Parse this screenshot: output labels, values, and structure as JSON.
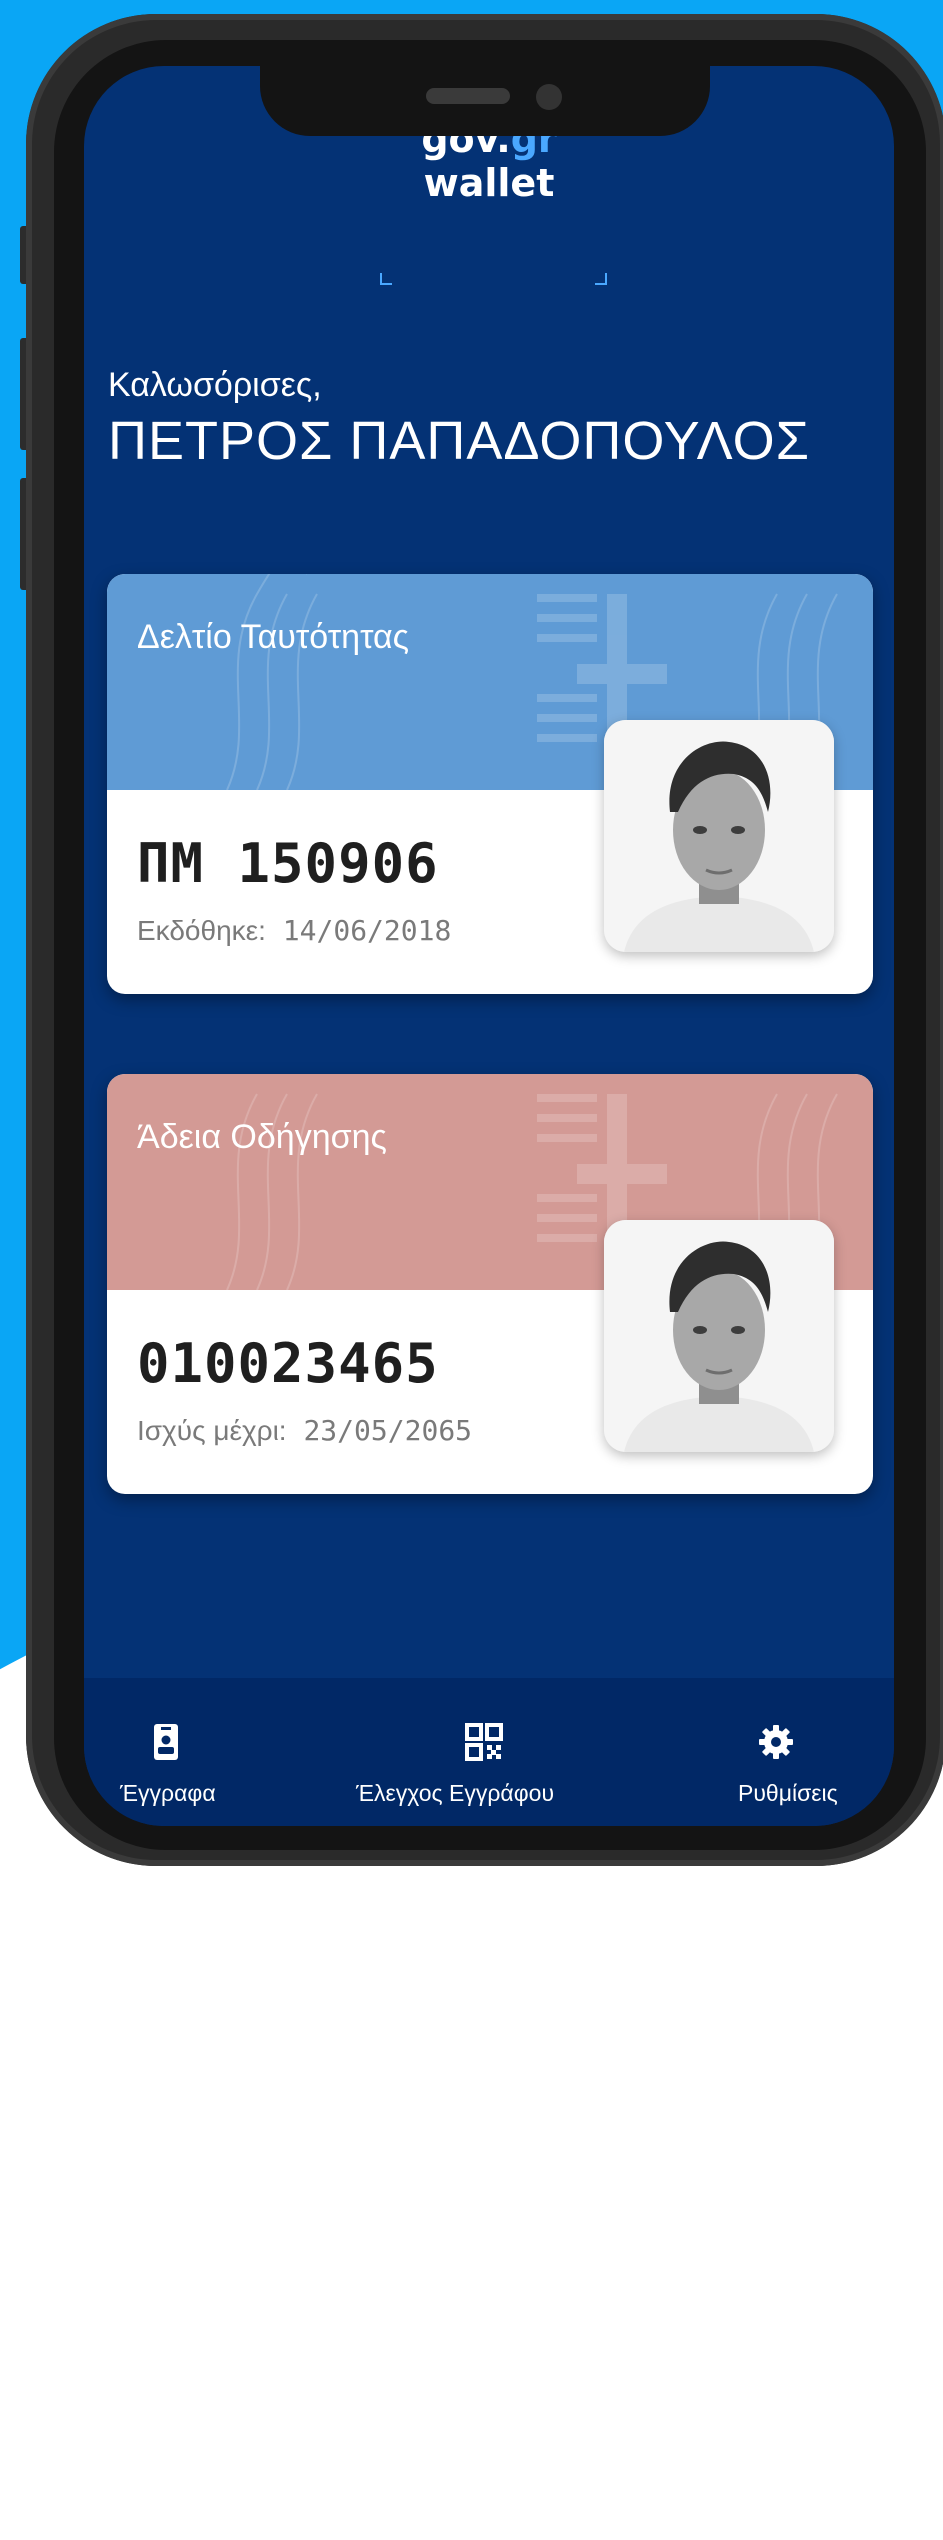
{
  "header": {
    "logo_line1": "gov.",
    "logo_line1_accent": "gr",
    "logo_line2": "wallet"
  },
  "greeting": "Καλωσόρισες,",
  "user_name": "ΠΕΤΡΟΣ ΠΑΠΑΔΟΠΟΥΛΟΣ",
  "cards": [
    {
      "title": "Δελτίο Ταυτότητας",
      "number": "ΠΜ 150906",
      "sub_label": "Εκδόθηκε:",
      "sub_value": "14/06/2018",
      "color": "#5f9bd5"
    },
    {
      "title": "Άδεια Οδήγησης",
      "number": "010023465",
      "sub_label": "Ισχύς μέχρι:",
      "sub_value": "23/05/2065",
      "color": "#d39a95"
    }
  ],
  "nav": [
    {
      "label": "Έγγραφα",
      "icon": "id-card-icon"
    },
    {
      "label": "Έλεγχος Εγγράφου",
      "icon": "qr-code-icon"
    },
    {
      "label": "Ρυθμίσεις",
      "icon": "gear-icon"
    }
  ],
  "colors": {
    "background": "#0aa6f5",
    "screen": "#043275",
    "navbar": "#012866",
    "accent": "#4aa8ff"
  }
}
